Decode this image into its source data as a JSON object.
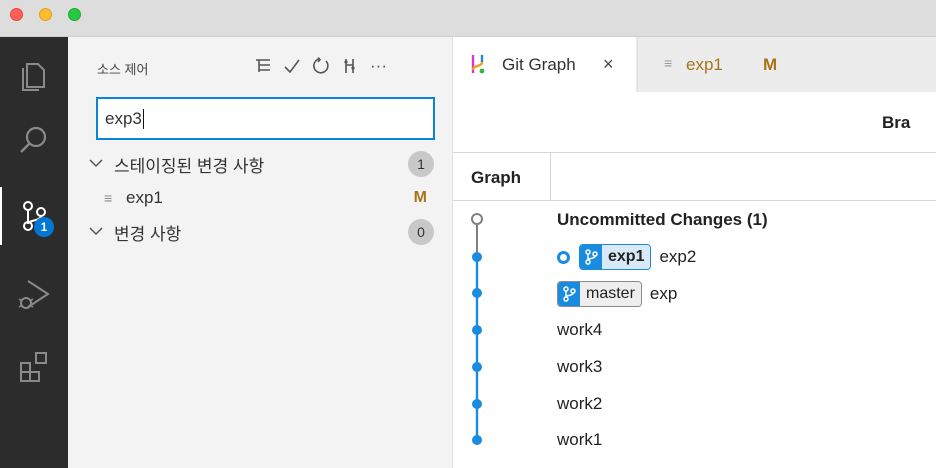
{
  "window": {
    "controls": [
      "close",
      "minimize",
      "zoom"
    ]
  },
  "activity_bar": {
    "items": [
      {
        "name": "explorer",
        "icon": "files-icon"
      },
      {
        "name": "search",
        "icon": "search-icon"
      },
      {
        "name": "source-control",
        "icon": "source-control-icon",
        "badge": "1",
        "active": true
      },
      {
        "name": "run-debug",
        "icon": "run-debug-icon"
      },
      {
        "name": "extensions",
        "icon": "extensions-icon"
      }
    ]
  },
  "sidebar": {
    "title": "소스 제어",
    "actions": [
      {
        "name": "view-as-tree",
        "glyph": "☰"
      },
      {
        "name": "commit",
        "glyph": "✓"
      },
      {
        "name": "refresh",
        "glyph": "↻"
      },
      {
        "name": "git-graph",
        "glyph": "⋔"
      },
      {
        "name": "more-actions",
        "glyph": "···"
      }
    ],
    "commit_message": "exp3",
    "staged": {
      "label": "스테이징된 변경 사항",
      "count": "1"
    },
    "staged_file": {
      "name": "exp1",
      "status": "M"
    },
    "changes": {
      "label": "변경 사항",
      "count": "0"
    }
  },
  "tabs": [
    {
      "label": "Git Graph",
      "close": "×",
      "active": true
    },
    {
      "label": "exp1",
      "modified": "M",
      "active": false
    }
  ],
  "git_graph": {
    "top_label": "Bra",
    "column_header": "Graph",
    "rows": [
      {
        "text": "Uncommitted Changes (1)",
        "bold": true
      },
      {
        "branch": "exp1",
        "text": "exp2",
        "is_head": true
      },
      {
        "branch": "master",
        "text": "exp"
      },
      {
        "text": "work4"
      },
      {
        "text": "work3"
      },
      {
        "text": "work2"
      },
      {
        "text": "work1"
      }
    ],
    "colors": {
      "graph_line": "#1a8ce0",
      "uncommitted_line": "#808080"
    }
  }
}
